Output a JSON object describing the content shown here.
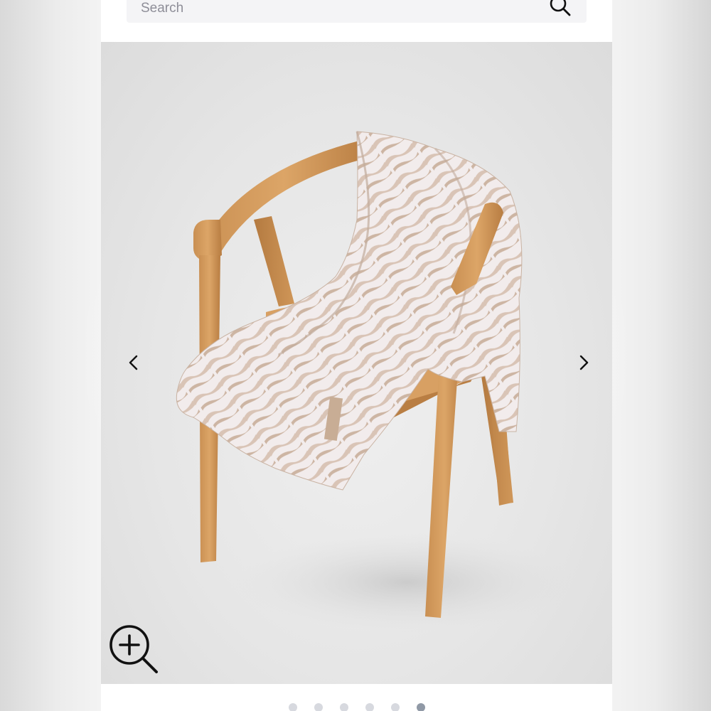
{
  "search": {
    "placeholder": "Search",
    "icon": "search-icon"
  },
  "gallery": {
    "image": "tie-dye-blanket-on-wooden-chair",
    "prev_icon": "chevron-left-icon",
    "next_icon": "chevron-right-icon",
    "zoom_icon": "zoom-in-icon",
    "total_images": 6,
    "active_index": 5
  },
  "colors": {
    "page_background": "#f3f3f3",
    "panel_background": "#ffffff",
    "search_background": "#f4f4f6",
    "photo_background": "#e6e6e6",
    "dot_inactive": "#d7d9df",
    "dot_active": "#9099a6",
    "icon": "#111111"
  }
}
